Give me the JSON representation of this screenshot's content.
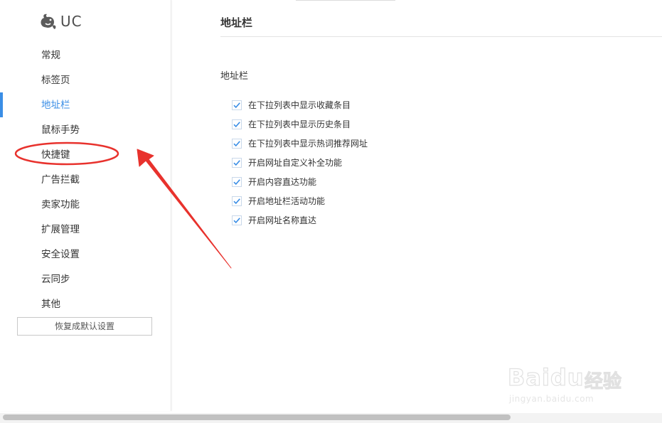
{
  "app": {
    "logo_text": "UC",
    "logo_icon": "uc-squirrel-icon"
  },
  "sidebar": {
    "items": [
      {
        "label": "常规",
        "active": false
      },
      {
        "label": "标签页",
        "active": false
      },
      {
        "label": "地址栏",
        "active": true
      },
      {
        "label": "鼠标手势",
        "active": false
      },
      {
        "label": "快捷键",
        "active": false
      },
      {
        "label": "广告拦截",
        "active": false
      },
      {
        "label": "卖家功能",
        "active": false
      },
      {
        "label": "扩展管理",
        "active": false
      },
      {
        "label": "安全设置",
        "active": false
      },
      {
        "label": "云同步",
        "active": false
      },
      {
        "label": "其他",
        "active": false
      }
    ],
    "reset_label": "恢复成默认设置"
  },
  "main": {
    "title": "地址栏",
    "section_label": "地址栏",
    "options": [
      {
        "label": "在下拉列表中显示收藏条目",
        "checked": true
      },
      {
        "label": "在下拉列表中显示历史条目",
        "checked": true
      },
      {
        "label": "在下拉列表中显示热词推荐网址",
        "checked": true
      },
      {
        "label": "开启网址自定义补全功能",
        "checked": true
      },
      {
        "label": "开启内容直达功能",
        "checked": true
      },
      {
        "label": "开启地址栏活动功能",
        "checked": true
      },
      {
        "label": "开启网址名称直达",
        "checked": true
      }
    ]
  },
  "annotation": {
    "highlight_color": "#e8322d",
    "target": "快捷键"
  },
  "watermark": {
    "brand": "Bai",
    "brand_suffix": "du",
    "cn": "经验",
    "url": "jingyan.baidu.com"
  },
  "colors": {
    "accent": "#3a8ee6",
    "checkmark": "#3a8ee6",
    "annotation": "#e8322d"
  }
}
